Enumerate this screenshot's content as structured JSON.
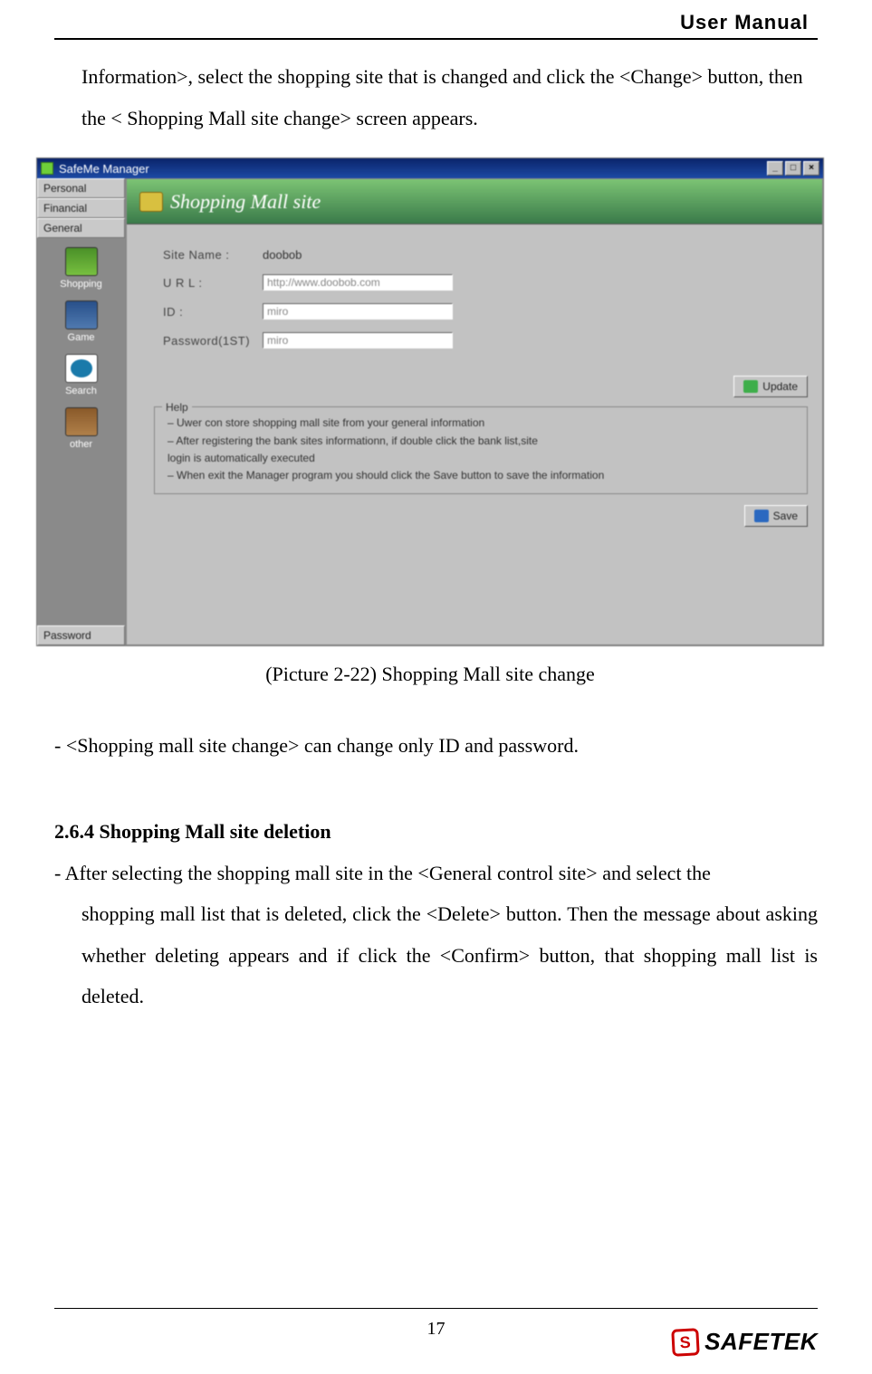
{
  "header": {
    "title": "User Manual"
  },
  "intro": {
    "text": "Information>, select the shopping site that is changed and click the <Change> button, then the < Shopping Mall site change> screen appears."
  },
  "figure": {
    "window": {
      "title": "SafeMe Manager",
      "min": "_",
      "max": "□",
      "close": "×",
      "tabs": {
        "personal": "Personal",
        "financial": "Financial",
        "general": "General",
        "password": "Password"
      },
      "icons": {
        "shopping": "Shopping",
        "game": "Game",
        "search": "Search",
        "other": "other"
      },
      "panel_title": "Shopping Mall site",
      "form": {
        "site_label": "Site Name :",
        "site_value": "doobob",
        "url_label": "U R L :",
        "url_value": "http://www.doobob.com",
        "id_label": "ID :",
        "id_value": "miro",
        "pw_label": "Password(1ST)",
        "pw_value": "miro"
      },
      "update_btn": "Update",
      "help": {
        "legend": "Help",
        "l1": "– Uwer con store shopping mall site from your general information",
        "l2": "– After registering the bank sites informationn, if double click the bank list,site",
        "l3": "   login is automatically executed",
        "l4": "– When exit the Manager program you should click the Save button to save the information"
      },
      "save_btn": "Save"
    },
    "caption": "(Picture 2-22) Shopping Mall site change"
  },
  "line_after": "- <Shopping mall site change> can change only ID and password.",
  "heading": "2.6.4 Shopping Mall site deletion",
  "para": {
    "prefix": "- After selecting the shopping mall site in the <General control site> and select the ",
    "rest": "shopping mall list that is deleted, click the <Delete> button. Then the message about asking whether deleting appears and if click the <Confirm> button, that shopping mall list is deleted."
  },
  "page_number": "17",
  "brand": "SAFETEK"
}
